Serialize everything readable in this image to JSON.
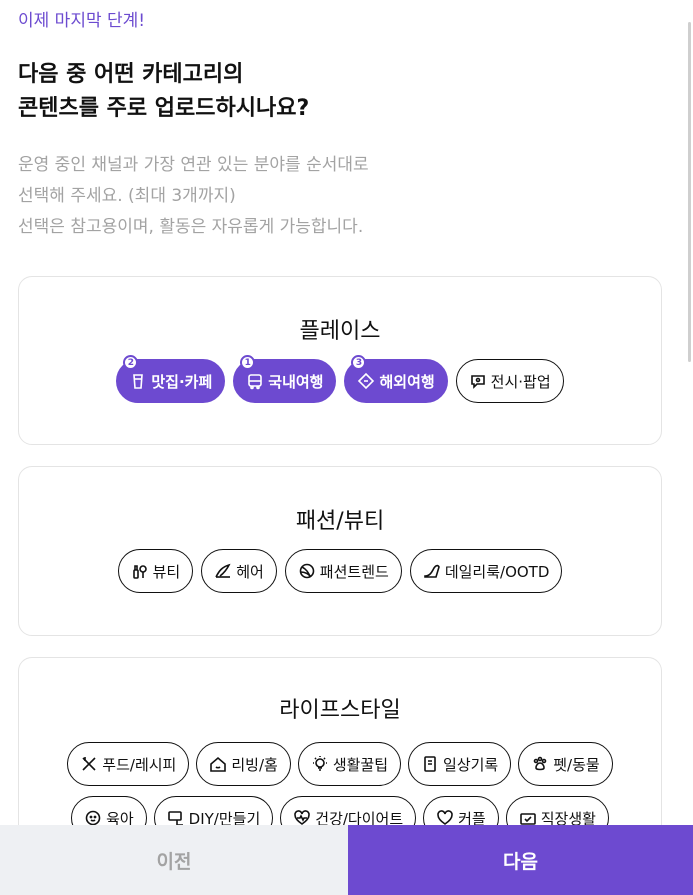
{
  "step_label": "이제 마지막 단계!",
  "title_line1": "다음 중 어떤 카테고리의",
  "title_line2": "콘텐츠를 주로 업로드하시나요?",
  "desc_line1": "운영 중인 채널과 가장 연관 있는 분야를 순서대로",
  "desc_line2": "선택해 주세요. (최대 3개까지)",
  "desc_line3": "선택은 참고용이며, 활동은 자유롭게 가능합니다.",
  "colors": {
    "accent": "#6d4ad0",
    "muted": "#a3a3a3",
    "border": "#e4e4e4"
  },
  "categories": [
    {
      "title": "플레이스",
      "chips": [
        {
          "label": "맛집·카페",
          "icon": "cup-icon",
          "selected": true,
          "order": "2"
        },
        {
          "label": "국내여행",
          "icon": "bus-icon",
          "selected": true,
          "order": "1"
        },
        {
          "label": "해외여행",
          "icon": "ticket-icon",
          "selected": true,
          "order": "3"
        },
        {
          "label": "전시·팝업",
          "icon": "exhibit-icon",
          "selected": false
        }
      ]
    },
    {
      "title": "패션/뷰티",
      "chips": [
        {
          "label": "뷰티",
          "icon": "cosmetics-icon",
          "selected": false
        },
        {
          "label": "헤어",
          "icon": "hair-icon",
          "selected": false
        },
        {
          "label": "패션트렌드",
          "icon": "yarn-icon",
          "selected": false
        },
        {
          "label": "데일리룩/OOTD",
          "icon": "heel-icon",
          "selected": false
        }
      ]
    },
    {
      "title": "라이프스타일",
      "chips_row1": [
        {
          "label": "푸드/레시피",
          "icon": "utensils-icon",
          "selected": false
        },
        {
          "label": "리빙/홈",
          "icon": "home-icon",
          "selected": false
        },
        {
          "label": "생활꿀팁",
          "icon": "bulb-icon",
          "selected": false
        },
        {
          "label": "일상기록",
          "icon": "notebook-icon",
          "selected": false
        },
        {
          "label": "펫/동물",
          "icon": "paw-icon",
          "selected": false
        }
      ],
      "chips_row2": [
        {
          "label": "육아",
          "icon": "baby-icon",
          "selected": false
        },
        {
          "label": "DIY/만들기",
          "icon": "craft-icon",
          "selected": false
        },
        {
          "label": "건강/다이어트",
          "icon": "health-icon",
          "selected": false
        },
        {
          "label": "커플",
          "icon": "heart-icon",
          "selected": false
        },
        {
          "label": "직장생활",
          "icon": "briefcase-icon",
          "selected": false
        }
      ]
    }
  ],
  "buttons": {
    "prev": "이전",
    "next": "다음"
  }
}
